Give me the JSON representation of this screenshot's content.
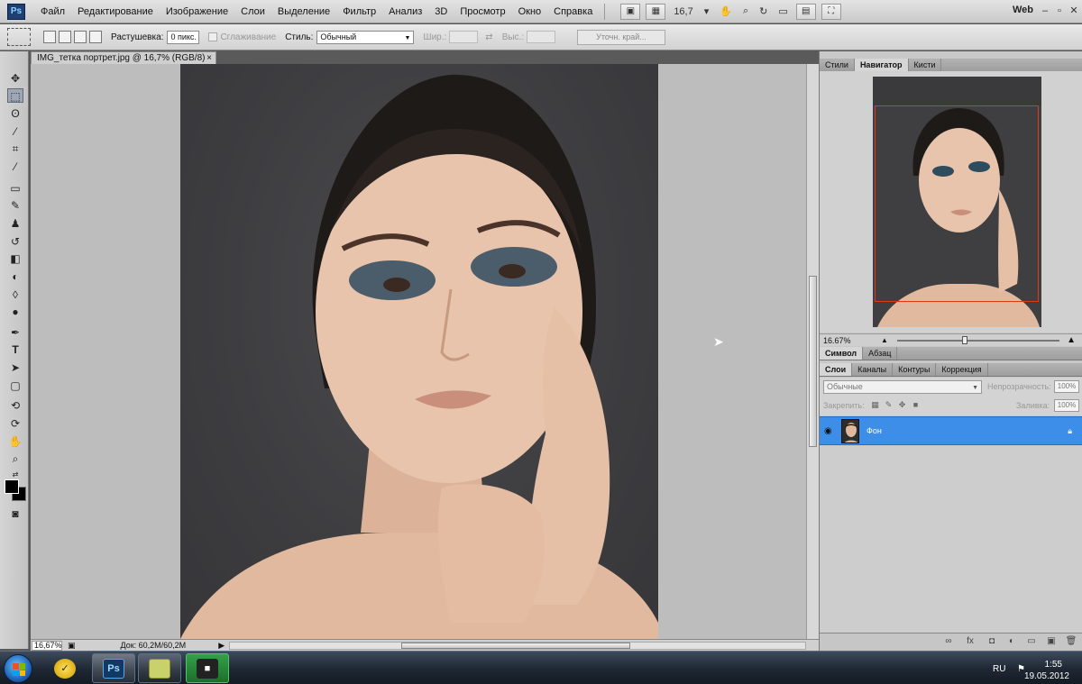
{
  "app": {
    "logo": "Ps"
  },
  "menu": {
    "items": [
      "Файл",
      "Редактирование",
      "Изображение",
      "Слои",
      "Выделение",
      "Фильтр",
      "Анализ",
      "3D",
      "Просмотр",
      "Окно",
      "Справка"
    ],
    "zoom": "16,7",
    "workspace": "Web"
  },
  "options": {
    "feather_label": "Растушевка:",
    "feather_value": "0 пикс.",
    "antialias_label": "Сглаживание",
    "style_label": "Стиль:",
    "style_value": "Обычный",
    "width_label": "Шир.:",
    "height_label": "Выс.:",
    "refine_label": "Уточн. край..."
  },
  "document": {
    "tab_title": "IMG_тетка портрет.jpg @ 16,7% (RGB/8)",
    "close": "×",
    "status_zoom": "16,67%",
    "status_doc": "Док: 60,2M/60,2M"
  },
  "panels": {
    "top_tabs": [
      "Стили",
      "Навигатор",
      "Кисти"
    ],
    "top_active": 1,
    "nav_zoom": "16.67%",
    "mid_tabs": [
      "Символ",
      "Абзац"
    ],
    "layer_tabs": [
      "Слои",
      "Каналы",
      "Контуры",
      "Коррекция"
    ],
    "blend_mode": "Обычные",
    "opacity_label": "Непрозрачность:",
    "opacity_value": "100%",
    "lock_label": "Закрепить:",
    "fill_label": "Заливка:",
    "fill_value": "100%",
    "layer_name": "Фон"
  },
  "taskbar": {
    "lang": "RU",
    "time": "1:55",
    "date": "19.05.2012"
  },
  "colors": {
    "layer_selected": "#3d8ee8",
    "nav_view_rect": "#e2361a",
    "backdrop": "#3f3f42"
  }
}
